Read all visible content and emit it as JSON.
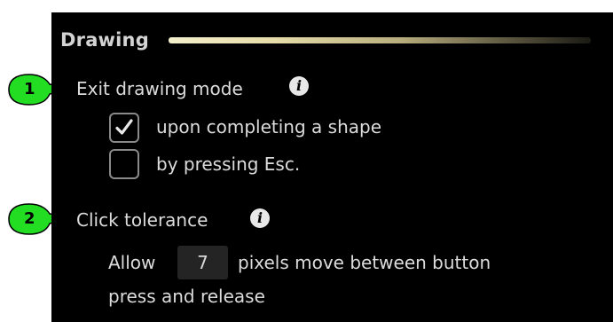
{
  "section": {
    "title": "Drawing"
  },
  "exit_drawing_mode": {
    "label": "Exit drawing mode",
    "callout": "1",
    "info_icon": "info-icon",
    "options": [
      {
        "label": "upon completing a shape",
        "checked": true
      },
      {
        "label": "by pressing Esc.",
        "checked": false
      }
    ]
  },
  "click_tolerance": {
    "label": "Click tolerance",
    "callout": "2",
    "info_icon": "info-icon",
    "prefix": "Allow",
    "value": "7",
    "suffix": "pixels move between button",
    "suffix_line2": "press and release"
  },
  "colors": {
    "panel_bg": "#000000",
    "callout_green": "#22dd22",
    "text": "#dcdcdc"
  }
}
